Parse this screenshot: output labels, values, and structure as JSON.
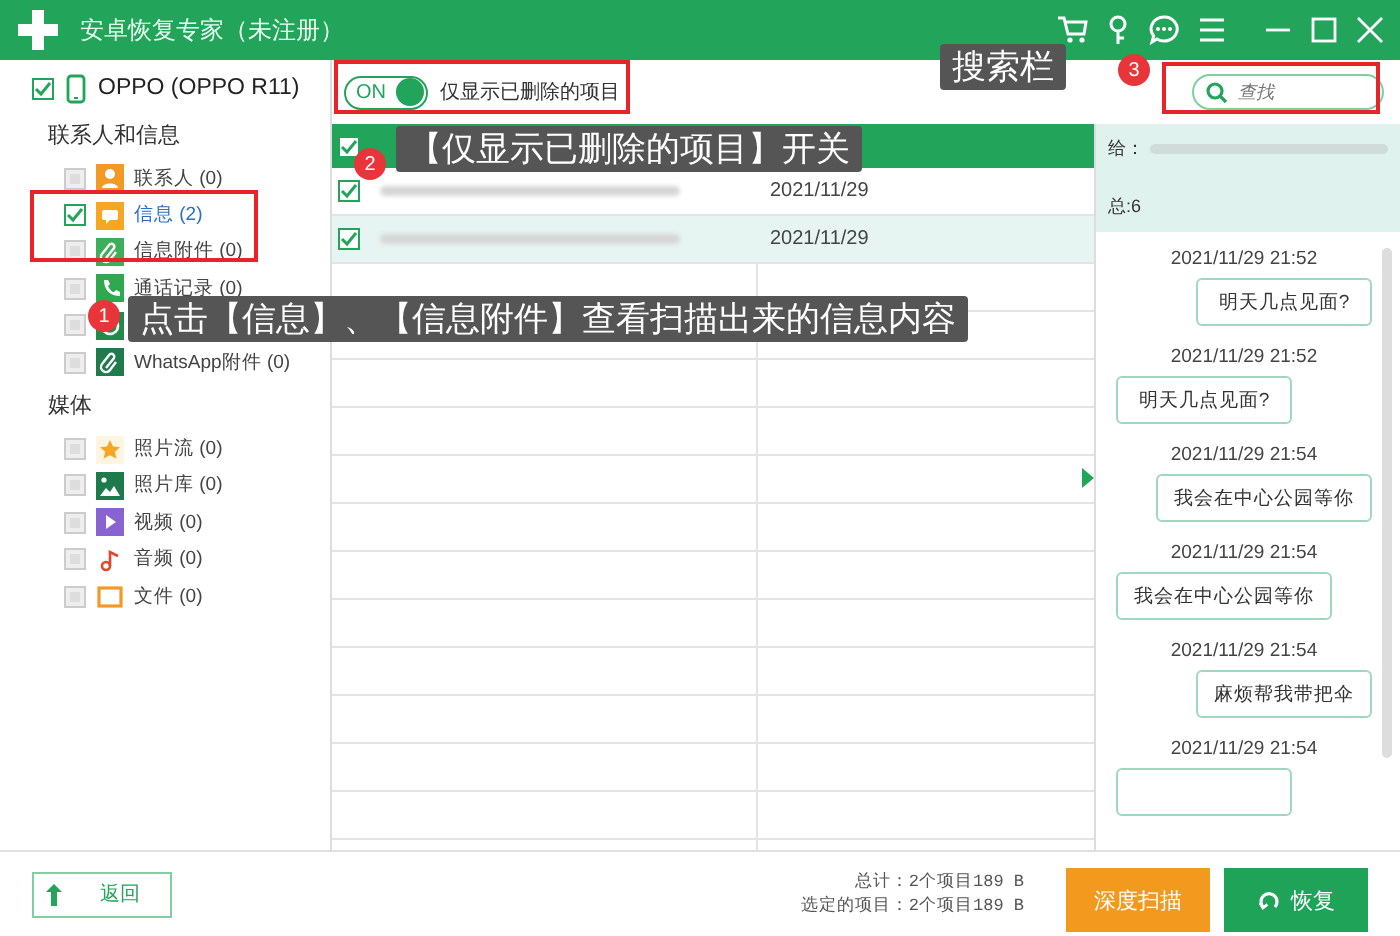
{
  "window": {
    "title": "安卓恢复专家（未注册）"
  },
  "sidebar": {
    "device": {
      "label": "OPPO (OPPO R11)",
      "checked": true
    },
    "groups": [
      {
        "title": "联系人和信息",
        "items": [
          {
            "kind": "contacts",
            "label": "联系人 (0)",
            "checked": false,
            "selected": false
          },
          {
            "kind": "messages",
            "label": "信息 (2)",
            "checked": true,
            "selected": true
          },
          {
            "kind": "attachments",
            "label": "信息附件 (0)",
            "checked": false,
            "selected": false
          },
          {
            "kind": "calls",
            "label": "通话记录 (0)",
            "checked": false,
            "selected": false
          },
          {
            "kind": "whatsapp",
            "checked": false,
            "selected": false
          },
          {
            "kind": "whatsapp-attachments",
            "label": "WhatsApp附件 (0)",
            "checked": false,
            "selected": false
          }
        ]
      },
      {
        "title": "媒体",
        "items": [
          {
            "kind": "photo-stream",
            "label": "照片流 (0)",
            "checked": false,
            "selected": false
          },
          {
            "kind": "photo-library",
            "label": "照片库 (0)",
            "checked": false,
            "selected": false
          },
          {
            "kind": "video",
            "label": "视频 (0)",
            "checked": false,
            "selected": false
          },
          {
            "kind": "audio",
            "label": "音频 (0)",
            "checked": false,
            "selected": false
          },
          {
            "kind": "files",
            "label": "文件 (0)",
            "checked": false,
            "selected": false
          }
        ]
      }
    ]
  },
  "toolbar": {
    "toggle": {
      "label": "ON",
      "on": true
    },
    "toggle_text": "仅显示已删除的项目",
    "search": {
      "placeholder": "查找"
    }
  },
  "table": {
    "header_checked": true,
    "rows": [
      {
        "checked": true,
        "selected": false,
        "date": "2021/11/29"
      },
      {
        "checked": true,
        "selected": true,
        "date": "2021/11/29"
      }
    ]
  },
  "detail": {
    "to_label": "给：",
    "total": "总:6",
    "messages": [
      {
        "time": "2021/11/29 21:52",
        "kind": "sent",
        "text": "明天几点见面?"
      },
      {
        "time": "2021/11/29 21:52",
        "kind": "received",
        "text": "明天几点见面?"
      },
      {
        "time": "2021/11/29 21:54",
        "kind": "sent",
        "text": "我会在中心公园等你"
      },
      {
        "time": "2021/11/29 21:54",
        "kind": "received",
        "text": "我会在中心公园等你"
      },
      {
        "time": "2021/11/29 21:54",
        "kind": "sent",
        "text": "麻烦帮我带把伞"
      },
      {
        "time": "2021/11/29 21:54",
        "kind": "received"
      }
    ]
  },
  "footer": {
    "back": "返回",
    "total": "总计：2个项目189 B",
    "selected": "选定的项目：2个项目189 B",
    "deep_scan": "深度扫描",
    "recover": "恢复"
  },
  "annotations": [
    {
      "number": "3",
      "text": "搜索栏"
    },
    {
      "number": "2",
      "text": "【仅显示已删除的项目】开关"
    },
    {
      "number": "1",
      "text": "点击【信息】、【信息附件】查看扫描出来的信息内容"
    }
  ]
}
